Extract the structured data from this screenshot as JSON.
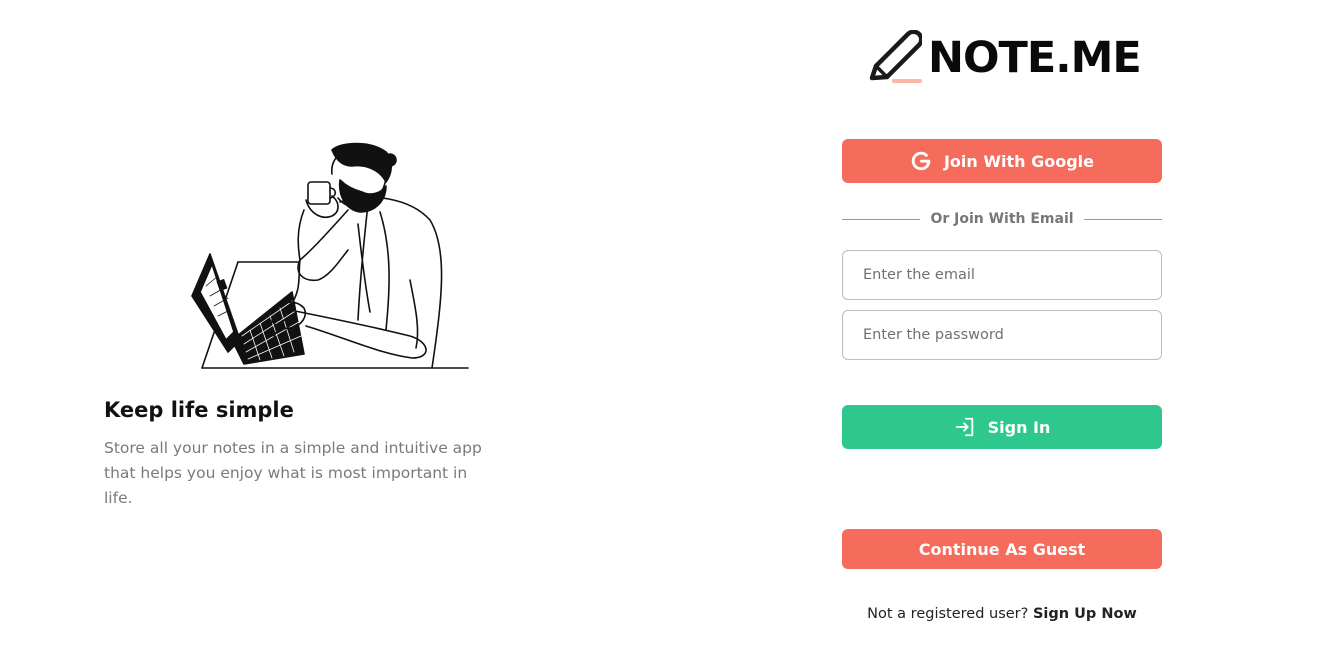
{
  "brand": {
    "name": "NOTE.ME",
    "accent_color": "#f56b5c",
    "underline_color": "#f9b8a8"
  },
  "hero": {
    "illustration": "man-drinking-coffee-at-laptop-illustration",
    "title": "Keep life simple",
    "description": "Store all your notes in a simple and intuitive app that helps you enjoy what is most important in life."
  },
  "auth": {
    "google_button": {
      "label": "Join With Google",
      "icon": "google-icon",
      "color": "#f56b5c"
    },
    "divider_label": "Or Join With Email",
    "email_field": {
      "placeholder": "Enter the email",
      "value": ""
    },
    "password_field": {
      "placeholder": "Enter the password",
      "value": ""
    },
    "signin_button": {
      "label": "Sign In",
      "icon": "sign-in-icon",
      "color": "#2ec88e"
    },
    "guest_button": {
      "label": "Continue As Guest",
      "color": "#f56b5c"
    },
    "signup_prompt": "Not a registered user?",
    "signup_link": "Sign Up Now"
  }
}
